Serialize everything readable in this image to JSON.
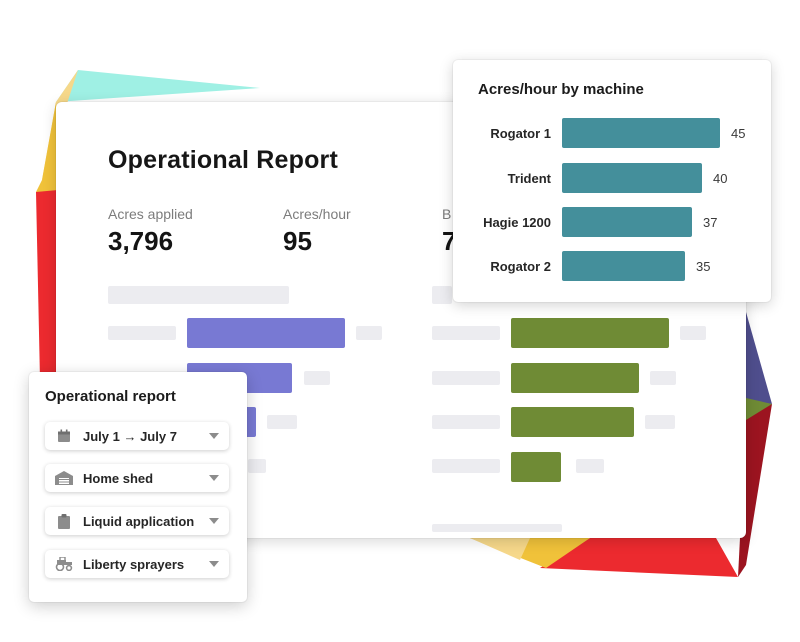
{
  "report": {
    "title": "Operational Report",
    "stats": [
      {
        "label": "Acres applied",
        "value": "3,796"
      },
      {
        "label": "Acres/hour",
        "value": "95"
      },
      {
        "label": "B",
        "value": "7"
      }
    ]
  },
  "machine_chart": {
    "title": "Acres/hour by machine",
    "chart_data": {
      "type": "bar",
      "orientation": "horizontal",
      "title": "Acres/hour by machine",
      "categories": [
        "Rogator 1",
        "Trident",
        "Hagie 1200",
        "Rogator 2"
      ],
      "values": [
        45,
        40,
        37,
        35
      ],
      "color": "#448f9b"
    }
  },
  "filters": {
    "title": "Operational report",
    "items": [
      {
        "label": "July 1 → July 7",
        "icon": "calendar-icon"
      },
      {
        "label": "Home shed",
        "icon": "shed-icon"
      },
      {
        "label": "Liquid application",
        "icon": "clipboard-icon"
      },
      {
        "label": "Liberty sprayers",
        "icon": "tractor-icon"
      }
    ]
  },
  "colors": {
    "accent_purple": "#7879d3",
    "accent_olive": "#6f8b35",
    "bar_teal": "#448f9b"
  }
}
